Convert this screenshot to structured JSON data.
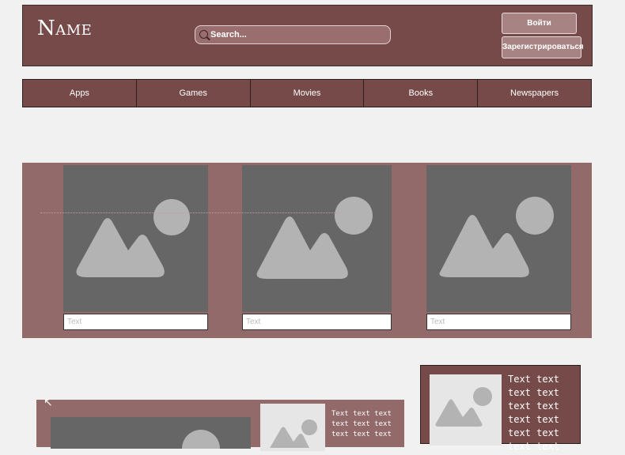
{
  "header": {
    "logo": "Name",
    "search_placeholder": "Search...",
    "login_label": "Войти",
    "register_label": "Зарегистрироваться"
  },
  "nav": {
    "items": [
      "Apps",
      "Games",
      "Movies",
      "Books",
      "Newspapers"
    ]
  },
  "gallery": {
    "cards": [
      {
        "caption": "Text",
        "icon": "image-placeholder-icon"
      },
      {
        "caption": "Text",
        "icon": "image-placeholder-icon"
      },
      {
        "caption": "Text",
        "icon": "image-placeholder-icon"
      }
    ]
  },
  "lower": {
    "panel_text": "Text text text text text text text text text",
    "side_text": "Text text text text text text text text text text text text"
  },
  "colors": {
    "header_bg": "#774a4a",
    "gallery_bg": "#936a6a",
    "placeholder_dark": "#666666",
    "placeholder_shape": "#b3b3b3",
    "page_bg": "#f1f1f1"
  }
}
